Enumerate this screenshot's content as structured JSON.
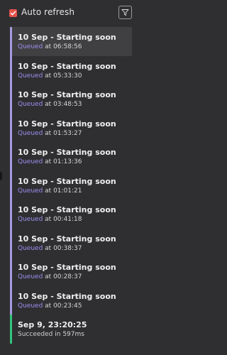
{
  "header": {
    "auto_refresh_label": "Auto refresh",
    "auto_refresh_checked": true,
    "filter_icon": "filter-icon",
    "accent_color": "#e5534b"
  },
  "runs": [
    {
      "title": "10 Sep - Starting soon",
      "status": "Queued",
      "connector": "at",
      "time": "06:58:56"
    },
    {
      "title": "10 Sep - Starting soon",
      "status": "Queued",
      "connector": "at",
      "time": "05:33:30"
    },
    {
      "title": "10 Sep - Starting soon",
      "status": "Queued",
      "connector": "at",
      "time": "03:48:53"
    },
    {
      "title": "10 Sep - Starting soon",
      "status": "Queued",
      "connector": "at",
      "time": "01:53:27"
    },
    {
      "title": "10 Sep - Starting soon",
      "status": "Queued",
      "connector": "at",
      "time": "01:13:36"
    },
    {
      "title": "10 Sep - Starting soon",
      "status": "Queued",
      "connector": "at",
      "time": "01:01:21"
    },
    {
      "title": "10 Sep - Starting soon",
      "status": "Queued",
      "connector": "at",
      "time": "00:41:18"
    },
    {
      "title": "10 Sep - Starting soon",
      "status": "Queued",
      "connector": "at",
      "time": "00:38:37"
    },
    {
      "title": "10 Sep - Starting soon",
      "status": "Queued",
      "connector": "at",
      "time": "00:28:37"
    },
    {
      "title": "10 Sep - Starting soon",
      "status": "Queued",
      "connector": "at",
      "time": "00:23:45"
    },
    {
      "title": "Sep 9, 23:20:25",
      "status": "Succeeded",
      "connector": "in",
      "time": "597ms"
    }
  ],
  "colors": {
    "queued": "#9b8ff0",
    "queued_bar": "#a79ae0",
    "succeeded_bar": "#33c37c"
  }
}
